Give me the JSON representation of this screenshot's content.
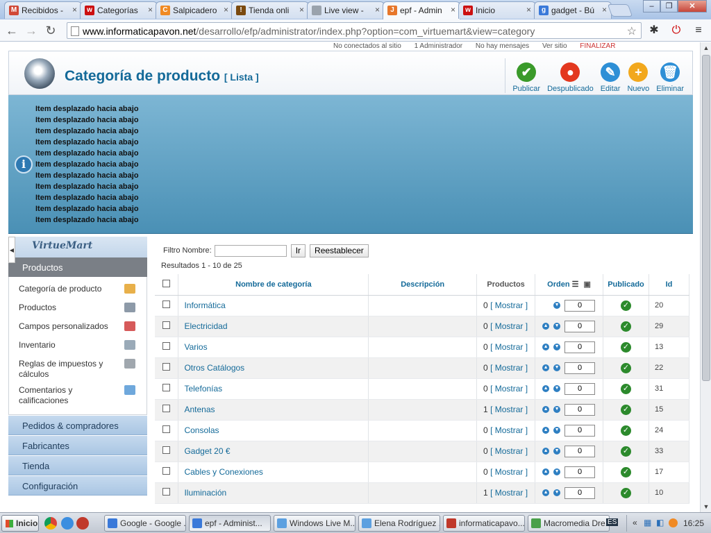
{
  "browser": {
    "tabs": [
      {
        "title": "Recibidos - ",
        "favicon_color": "#d14836",
        "favicon_glyph": "M",
        "active": false
      },
      {
        "title": "Categorías",
        "favicon_color": "#cc1010",
        "favicon_glyph": "w",
        "active": false
      },
      {
        "title": "Salpicadero",
        "favicon_color": "#f08a24",
        "favicon_glyph": "C",
        "active": false
      },
      {
        "title": "Tienda onli",
        "favicon_color": "#7a4a10",
        "favicon_glyph": "!",
        "active": false
      },
      {
        "title": "Live view - ",
        "favicon_color": "#9aa3ad",
        "favicon_glyph": "",
        "active": false
      },
      {
        "title": "epf - Admin",
        "favicon_color": "#e7772b",
        "favicon_glyph": "J",
        "active": true
      },
      {
        "title": "Inicio",
        "favicon_color": "#cc1010",
        "favicon_glyph": "w",
        "active": false
      },
      {
        "title": "gadget - Bú",
        "favicon_color": "#3a79d9",
        "favicon_glyph": "g",
        "active": false
      }
    ],
    "url_host": "www.informaticapavon.net",
    "url_path": "/desarrollo/efp/administrator/index.php?option=com_virtuemart&view=category"
  },
  "status": {
    "not_connected": "No conectados al sitio",
    "admins": "1 Administrador",
    "messages": "No hay mensajes",
    "view_site": "Ver sitio",
    "logout": "FINALIZAR"
  },
  "header": {
    "title": "Categoría de producto",
    "subtitle": "[ Lista ]",
    "actions": [
      {
        "label": "Publicar",
        "color": "#3a9a2a",
        "glyph": "✔"
      },
      {
        "label": "Despublicado",
        "color": "#e3381f",
        "glyph": "●"
      },
      {
        "label": "Editar",
        "color": "#2e8fd6",
        "glyph": "✎"
      },
      {
        "label": "Nuevo",
        "color": "#f2a81d",
        "glyph": "+"
      },
      {
        "label": "Eliminar",
        "color": "#2e8fd6",
        "glyph": "🗑"
      }
    ]
  },
  "messages": [
    "Item desplazado hacia abajo",
    "Item desplazado hacia abajo",
    "Item desplazado hacia abajo",
    "Item desplazado hacia abajo",
    "Item desplazado hacia abajo",
    "Item desplazado hacia abajo",
    "Item desplazado hacia abajo",
    "Item desplazado hacia abajo",
    "Item desplazado hacia abajo",
    "Item desplazado hacia abajo",
    "Item desplazado hacia abajo"
  ],
  "sidebar": {
    "logo_text": "VirtueMart",
    "section_title": "Productos",
    "items": [
      {
        "label": "Categoría de producto",
        "icon_color": "#e8b04a"
      },
      {
        "label": "Productos",
        "icon_color": "#8d9aa8"
      },
      {
        "label": "Campos personalizados",
        "icon_color": "#d65a5a"
      },
      {
        "label": "Inventario",
        "icon_color": "#9aaab8"
      },
      {
        "label": "Reglas de impuestos y cálculos",
        "icon_color": "#a0a7ae"
      },
      {
        "label": "Comentarios y calificaciones",
        "icon_color": "#6fa8dc"
      }
    ],
    "sections": [
      "Pedidos & compradores",
      "Fabricantes",
      "Tienda",
      "Configuración"
    ]
  },
  "filter": {
    "label": "Filtro Nombre:",
    "value": "",
    "go_label": "Ir",
    "reset_label": "Reestablecer",
    "results": "Resultados 1 - 10 de 25"
  },
  "table": {
    "headers": {
      "name": "Nombre de categoría",
      "description": "Descripción",
      "products": "Productos",
      "order": "Orden",
      "published": "Publicado",
      "id": "Id"
    },
    "show_label": "[ Mostrar ]",
    "rows": [
      {
        "name": "Informática",
        "products": "0",
        "order": "0",
        "id": "20",
        "up": false
      },
      {
        "name": "Electricidad",
        "products": "0",
        "order": "0",
        "id": "29",
        "up": true
      },
      {
        "name": "Varios",
        "products": "0",
        "order": "0",
        "id": "13",
        "up": true
      },
      {
        "name": "Otros Catálogos",
        "products": "0",
        "order": "0",
        "id": "22",
        "up": true
      },
      {
        "name": "Telefonías",
        "products": "0",
        "order": "0",
        "id": "31",
        "up": true
      },
      {
        "name": "Antenas",
        "products": "1",
        "order": "0",
        "id": "15",
        "up": true
      },
      {
        "name": "Consolas",
        "products": "0",
        "order": "0",
        "id": "24",
        "up": true
      },
      {
        "name": "Gadget 20 €",
        "products": "0",
        "order": "0",
        "id": "33",
        "up": true
      },
      {
        "name": "Cables y Conexiones",
        "products": "0",
        "order": "0",
        "id": "17",
        "up": true
      },
      {
        "name": "Iluminación",
        "products": "1",
        "order": "0",
        "id": "10",
        "up": true
      }
    ]
  },
  "taskbar": {
    "start": "Inicio",
    "tasks": [
      {
        "label": "Google - Google ...",
        "color": "#3a79d9",
        "active": false
      },
      {
        "label": "epf - Administ...",
        "color": "#3a79d9",
        "active": true
      },
      {
        "label": "Windows Live M...",
        "color": "#5ca0e0",
        "active": false
      },
      {
        "label": "Elena Rodríguez ...",
        "color": "#5ca0e0",
        "active": false
      },
      {
        "label": "informaticapavo...",
        "color": "#c0392b",
        "active": false
      },
      {
        "label": "Macromedia Dre...",
        "color": "#4aa04a",
        "active": false
      }
    ],
    "lang": "ES",
    "time": "16:25"
  }
}
